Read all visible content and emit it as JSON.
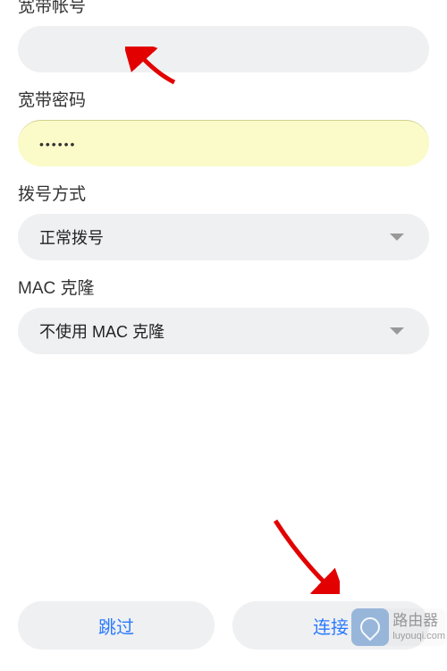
{
  "fields": {
    "account": {
      "label": "宽带帐号",
      "value": ""
    },
    "password": {
      "label": "宽带密码",
      "value": "••••••"
    },
    "dialMode": {
      "label": "拨号方式",
      "selected": "正常拨号"
    },
    "macClone": {
      "label": "MAC 克隆",
      "selected": "不使用 MAC 克隆"
    }
  },
  "buttons": {
    "skip": "跳过",
    "connect": "连接"
  },
  "watermark": {
    "title": "路由器",
    "subtitle": "luyouqi.com"
  },
  "colors": {
    "accent": "#2a7aff",
    "arrow": "#e20000",
    "pillBg": "#eff0f2",
    "passwordBg": "#fafbc8"
  },
  "annotations": {
    "arrow1": "points-to-account-field",
    "arrow2": "points-to-connect-button"
  }
}
